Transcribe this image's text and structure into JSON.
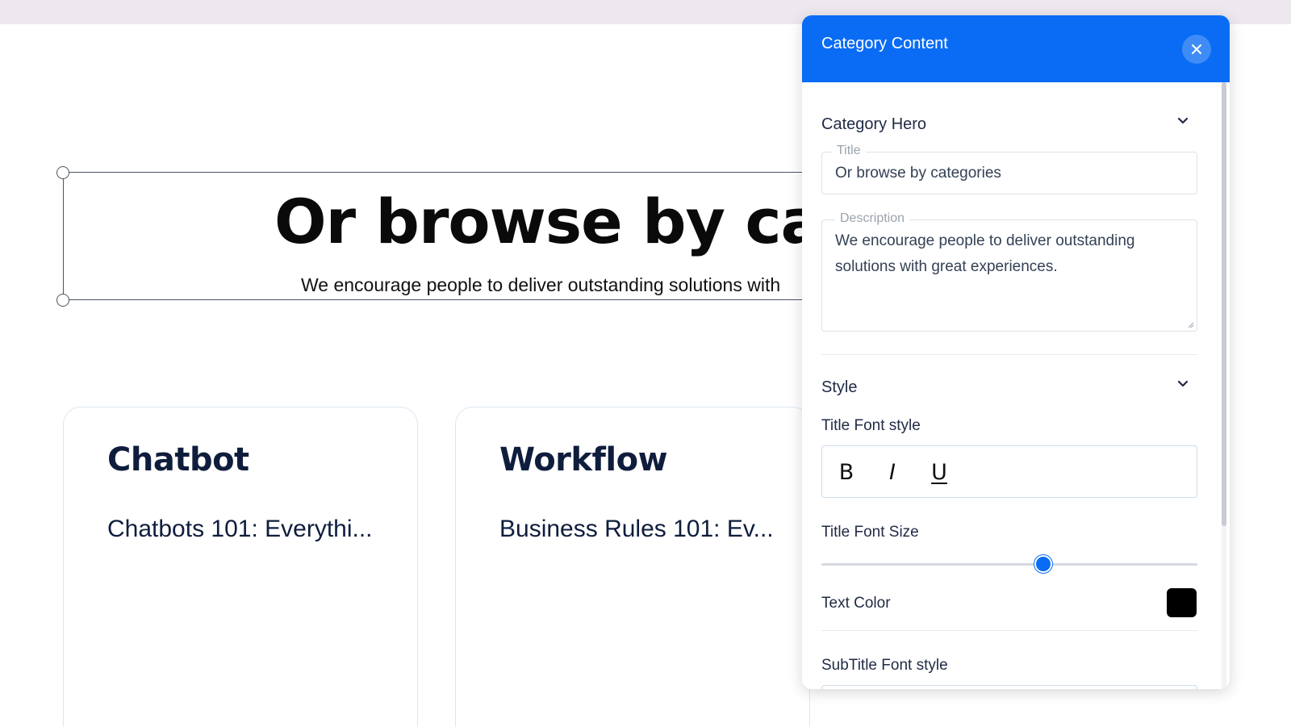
{
  "canvas": {
    "hero": {
      "title": "Or browse by cate",
      "description": "We encourage people to deliver outstanding solutions with"
    },
    "cards": [
      {
        "title": "Chatbot",
        "link": "Chatbots 101: Everythi..."
      },
      {
        "title": "Workflow",
        "link": "Business Rules 101: Ev..."
      }
    ]
  },
  "panel": {
    "title": "Category Content",
    "close_icon": "close-icon",
    "sections": {
      "hero": {
        "title": "Category Hero",
        "title_field": {
          "label": "Title",
          "value": "Or browse by categories"
        },
        "description_field": {
          "label": "Description",
          "value": "We encourage people to deliver outstanding solutions with great experiences."
        }
      },
      "style": {
        "title": "Style",
        "title_font_style_label": "Title Font style",
        "bold_label": "B",
        "italic_label": "I",
        "underline_label": "U",
        "title_font_size_label": "Title Font Size",
        "title_font_size_level": 0.59,
        "text_color_label": "Text Color",
        "text_color": "#000000",
        "subtitle_font_style_label": "SubTitle Font style"
      }
    }
  },
  "colors": {
    "accent": "#0a6cf5",
    "topbar": "#ece8ee"
  }
}
